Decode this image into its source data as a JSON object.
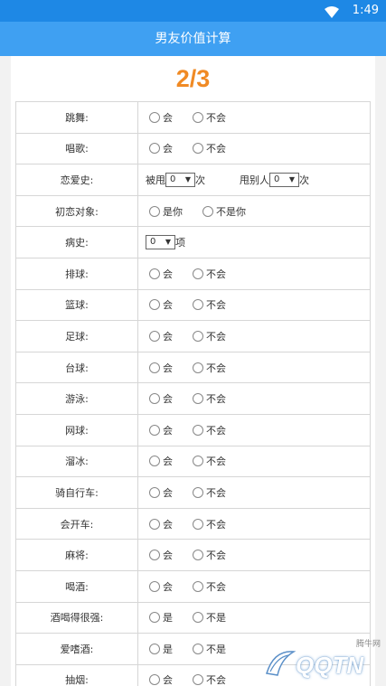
{
  "status": {
    "time": "1:49"
  },
  "appbar": {
    "title": "男友价值计算"
  },
  "progress": "2/3",
  "rows": [
    {
      "label": "跳舞:",
      "opt1": "会",
      "opt2": "不会"
    },
    {
      "label": "唱歌:",
      "opt1": "会",
      "opt2": "不会"
    },
    {
      "label": "恋爱史:",
      "prefix1": "被甩",
      "select1": "0",
      "suffix1": "次",
      "prefix2": "甩别人",
      "select2": "0",
      "suffix2": "次"
    },
    {
      "label": "初恋对象:",
      "opt1": "是你",
      "opt2": "不是你"
    },
    {
      "label": "病史:",
      "select1": "0",
      "suffix1": "项"
    },
    {
      "label": "排球:",
      "opt1": "会",
      "opt2": "不会"
    },
    {
      "label": "篮球:",
      "opt1": "会",
      "opt2": "不会"
    },
    {
      "label": "足球:",
      "opt1": "会",
      "opt2": "不会"
    },
    {
      "label": "台球:",
      "opt1": "会",
      "opt2": "不会"
    },
    {
      "label": "游泳:",
      "opt1": "会",
      "opt2": "不会"
    },
    {
      "label": "网球:",
      "opt1": "会",
      "opt2": "不会"
    },
    {
      "label": "溜冰:",
      "opt1": "会",
      "opt2": "不会"
    },
    {
      "label": "骑自行车:",
      "opt1": "会",
      "opt2": "不会"
    },
    {
      "label": "会开车:",
      "opt1": "会",
      "opt2": "不会"
    },
    {
      "label": "麻将:",
      "opt1": "会",
      "opt2": "不会"
    },
    {
      "label": "喝酒:",
      "opt1": "会",
      "opt2": "不会"
    },
    {
      "label": "酒喝得很强:",
      "opt1": "是",
      "opt2": "不是"
    },
    {
      "label": "爱嗜酒:",
      "opt1": "是",
      "opt2": "不是"
    },
    {
      "label": "抽烟:",
      "opt1": "会",
      "opt2": "不会"
    }
  ],
  "watermark": {
    "brand": "QQTN",
    "small": "腾牛网"
  },
  "colors": {
    "statusbar": "#1e88e5",
    "appbar": "#3fa0f2",
    "progress": "#f08a24"
  }
}
